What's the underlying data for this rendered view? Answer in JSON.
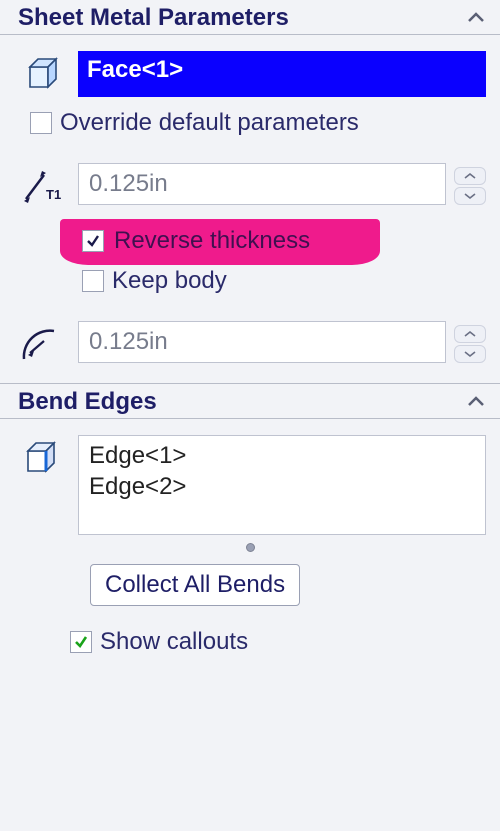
{
  "sections": {
    "sheetMetal": {
      "title": "Sheet Metal Parameters",
      "selection": "Face<1>",
      "overrideLabel": "Override default parameters",
      "overrideChecked": false,
      "thickness": "0.125in",
      "reverseThicknessLabel": "Reverse thickness",
      "reverseThicknessChecked": true,
      "keepBodyLabel": "Keep body",
      "keepBodyChecked": false,
      "radius": "0.125in"
    },
    "bendEdges": {
      "title": "Bend Edges",
      "items": [
        "Edge<1>",
        "Edge<2>"
      ],
      "collectLabel": "Collect All Bends",
      "showCalloutsLabel": "Show callouts",
      "showCalloutsChecked": true
    }
  }
}
